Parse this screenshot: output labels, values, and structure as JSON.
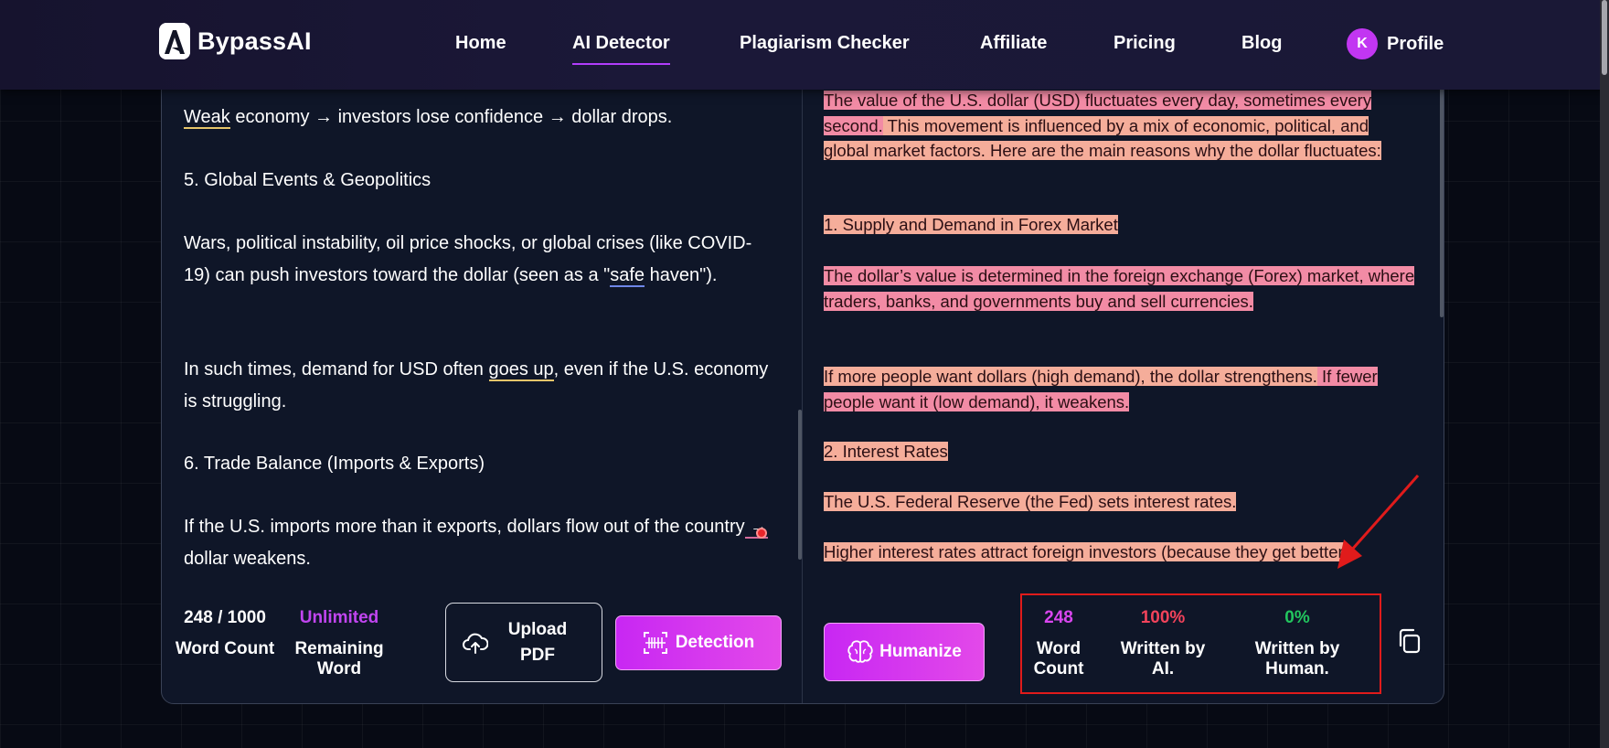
{
  "brand": {
    "name": "BypassAI"
  },
  "nav": {
    "items": [
      {
        "label": "Home"
      },
      {
        "label": "AI Detector"
      },
      {
        "label": "Plagiarism Checker"
      },
      {
        "label": "Affiliate"
      },
      {
        "label": "Pricing"
      },
      {
        "label": "Blog"
      }
    ],
    "active": "AI Detector",
    "profile": {
      "initial": "K",
      "label": "Profile"
    }
  },
  "input_text": {
    "p1": {
      "u": "Weak",
      "rest": " economy → investors lose confidence → dollar drops."
    },
    "p2": "5. Global Events & Geopolitics",
    "p3": {
      "a": "Wars, political instability, oil price shocks, or global crises (like COVID-19) can push investors toward the dollar (seen as a \"",
      "u": "safe",
      "b": " haven\")."
    },
    "p4": {
      "a": "In such times, demand for USD often ",
      "u": "goes up",
      "b": ", even if the U.S. economy is struggling."
    },
    "p5": "6. Trade Balance (Imports & Exports)",
    "p6": {
      "a": "If the U.S. imports more than it exports, dollars flow out of the country",
      "u": " →",
      "b": " dollar weakens."
    }
  },
  "left_stats": {
    "word_count": {
      "value": "248 / 1000",
      "label": "Word Count"
    },
    "remaining": {
      "value": "Unlimited",
      "label": "Remaining Word"
    }
  },
  "buttons": {
    "upload": "Upload PDF",
    "detection": "Detection",
    "humanize": "Humanize"
  },
  "result_text": {
    "p1": {
      "s1": "The value of the U.S. dollar (USD) fluctuates every day, sometimes every second.",
      "s2": " This movement is influenced by a mix of economic, political, and global market factors.",
      "s3": " Here are the main reasons why the dollar fluctuates:"
    },
    "p2": "1. Supply and Demand in Forex Market",
    "p3": "The dollar’s value is determined in the foreign exchange (Forex) market, where traders, banks, and governments buy and sell currencies.",
    "p4": {
      "s1": "If more people want dollars (high demand), the dollar strengthens.",
      "s2": " If fewer people want it (low demand), it weakens."
    },
    "p5": "2. Interest Rates",
    "p6": "The U.S. Federal Reserve (the Fed) sets interest rates.",
    "p7": {
      "s1": "Higher interest rates attract foreign investors (because they ge",
      "s2": "t better"
    }
  },
  "results": {
    "word_count": {
      "value": "248",
      "label": "Word Count"
    },
    "ai": {
      "value": "100%",
      "label": "Written by AI."
    },
    "human": {
      "value": "0%",
      "label": "Written by Human."
    }
  },
  "colors": {
    "accent": "#c827f3",
    "ai_value": "#f2435b",
    "human_value": "#22c55e",
    "word_count_value": "#d946ef",
    "highlight_pink": "#f28ba5",
    "highlight_peach": "#f5ad9a",
    "annotation_red": "#e01b1b"
  },
  "icons": [
    "upload-cloud-icon",
    "scan-icon",
    "brain-icon",
    "copy-icon",
    "annotation-arrow"
  ]
}
